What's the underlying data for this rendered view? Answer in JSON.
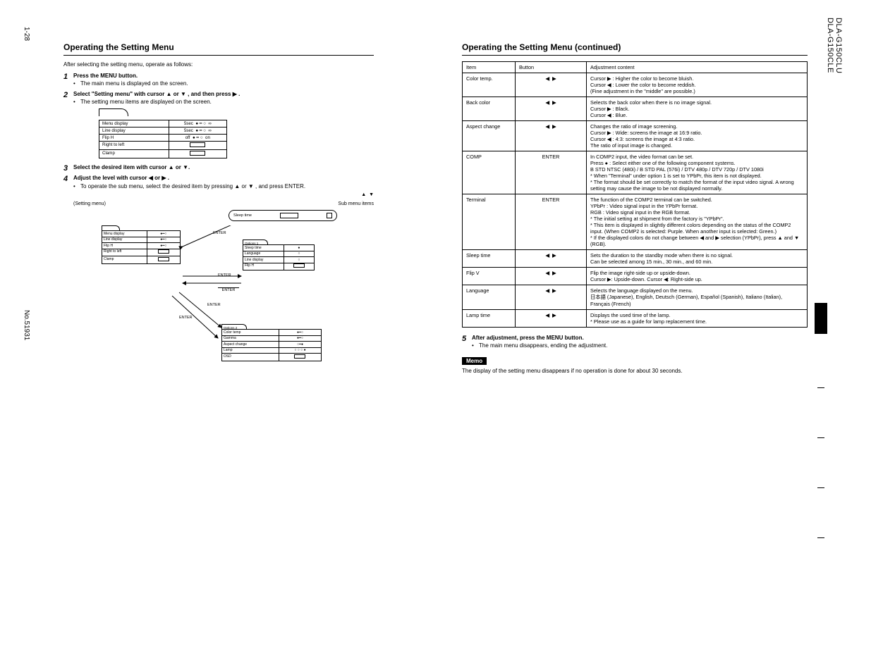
{
  "side_labels": {
    "model_a": "DLA-G150CLU",
    "model_b": "DLA-G150CLE",
    "page_num": "1-28",
    "doc_no": "No.51931"
  },
  "left": {
    "heading": "Operating the Setting Menu",
    "intro": "After selecting the setting menu, operate as follows:",
    "steps": {
      "s1": "Press the MENU button.",
      "s1_sub": "The main menu is displayed on the screen.",
      "s2_a": "Select \"Setting menu\" with cursor ",
      "s2_b": " or ",
      "s2_c": ", and then press ",
      "s2_d": ".",
      "s2_sub": "The setting menu items are displayed on the screen.",
      "osd1": {
        "r1l": "Menu display",
        "r1r_left": "5sec",
        "r1r_right": "∞",
        "r2l": "Line display",
        "r2r_left": "5sec",
        "r2r_right": "∞",
        "r3l": "Flip H",
        "r3r_left": "off",
        "r3r_right": "on",
        "r4l": "Right to left",
        "r5l": "Clamp"
      },
      "s3_a": "Select the desired item with cursor ",
      "s3_b": " or ",
      "s4_a": "Adjust the level with cursor ",
      "s4_b": " or ",
      "s4_c": ".",
      "s4_sub1": "To operate the sub menu, select the desired item by pressing ",
      "s4_sub2": " or ",
      "s4_sub3": ", and press ENTER.",
      "submenu": "(Setting menu)",
      "sublabel": "Sub menu items",
      "enter": "ENTER",
      "pill_left": "Sleep time",
      "mini_osd_a": {
        "r1l": "Menu display",
        "r2l": "Line display",
        "r3l": "Flip H",
        "r4l": "Right to left",
        "r5l": "Clamp"
      },
      "mini_osd_b_tab": "Options 1",
      "mini_osd_b": {
        "r1l": "Sleep time",
        "r2l": "Language",
        "r3l": "Line display",
        "r4l": "Flip H"
      },
      "mini_osd_c_tab": "Options 2",
      "mini_osd_c": {
        "r1l": "Color temp",
        "r2l": "Gamma",
        "r3l": "Aspect change",
        "r4l": "Lamp",
        "r5l": "OSD"
      }
    }
  },
  "right": {
    "heading_tail": " (continued)",
    "thead": [
      "Item",
      "Button",
      "Adjustment content"
    ],
    "rows": [
      {
        "item": "Color temp.",
        "btn": "◀ / ▶",
        "desc": "Cursor ▶ : Higher the color to become bluish.\nCursor ◀ : Lower the color to become reddish.\n(Fine adjustment in the \"middle\" are possible.)"
      },
      {
        "item": "Back color",
        "btn": "◀ / ▶",
        "desc": "Selects the back color when there is no image signal.\nCursor ▶ : Black.\nCursor ◀ : Blue."
      },
      {
        "item": "Aspect change",
        "btn": "◀ / ▶",
        "desc": "Changes the ratio of image screening.\nCursor ▶ : Wide: screens the image at 16:9 ratio.\nCursor ◀ : 4:3: screens the image at 4:3 ratio.\nThe ratio of input image is changed."
      },
      {
        "item": "COMP",
        "btn": "ENTER",
        "desc": "In COMP2 input, the video format can be set.\nPress ● : Select either one of the following component systems.\nB STD NTSC (480i) / B STD PAL (576i) / DTV 480p / DTV 720p / DTV 1080i\n* When \"Terminal\" under option 1 is set to YPbPr, this item is not displayed.\n* The format should be set correctly to match the format of the input video signal. A wrong setting may cause the image to be not displayed normally."
      },
      {
        "item": "Terminal",
        "btn": "ENTER",
        "desc": "The function of the COMP2 terminal can be switched.\nYPbPr : Video signal input in the YPbPr format.\nRGB : Video signal input in the RGB format.\n* The initial setting at shipment from the factory is \"YPbPr\".\n* This item is displayed in slightly different colors depending on the status of the COMP2 input. (When COMP2 is selected: Purple. When another input is selected: Green.)\n* If the displayed colors do not change between ◀ and ▶ selection (YPbPr), press ▲ and ▼ (RGB)."
      },
      {
        "item": "Sleep time",
        "btn": "◀ / ▶",
        "desc": "Sets the duration to the standby mode when there is no signal.\nCan be selected among 15 min., 30 min., and 60 min."
      },
      {
        "item": "Flip V",
        "btn": "◀ / ▶",
        "desc": "Flip the image right-side up or upside-down.\nCursor ▶: Upside-down. Cursor ◀: Right-side up."
      },
      {
        "item": "Language",
        "btn": "◀ / ▶",
        "desc": "Selects the language displayed on the menu.\n日本語 (Japanese), English, Deutsch (German), Español (Spanish), Italiano (Italian), Français (French)"
      },
      {
        "item": "Lamp time",
        "btn": "◀ / ▶",
        "desc": "Displays the used time of the lamp.\n* Please use as a guide for lamp replacement time."
      }
    ],
    "step5_a": "After adjustment, press the MENU button.",
    "step5_b": "The main menu disappears, ending the adjustment.",
    "memo": "Memo",
    "memo_text": "The display of the setting menu disappears if no operation is done for about 30 seconds."
  }
}
